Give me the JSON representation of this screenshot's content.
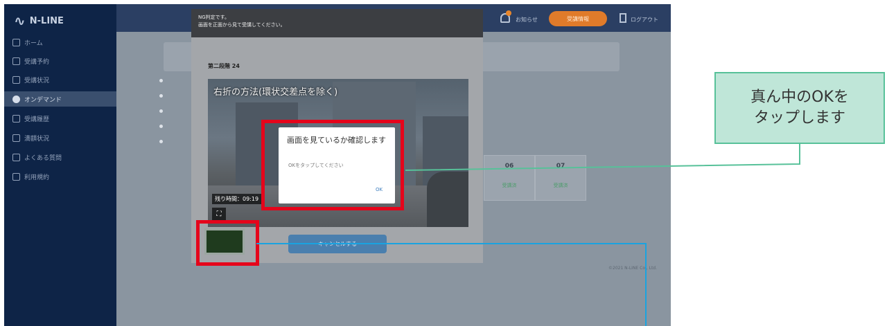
{
  "app": {
    "logo_text": "N-LINE",
    "nav_items": [
      {
        "label": "ホーム",
        "icon": "home-icon"
      },
      {
        "label": "受講予約",
        "icon": "calendar-icon"
      },
      {
        "label": "受講状況",
        "icon": "folder-icon"
      },
      {
        "label": "オンデマンド",
        "icon": "play-icon",
        "active": true
      },
      {
        "label": "受講履歴",
        "icon": "history-icon"
      },
      {
        "label": "満額状況",
        "icon": "people-icon"
      },
      {
        "label": "よくある質問",
        "icon": "faq-icon"
      },
      {
        "label": "利用規約",
        "icon": "terms-icon"
      }
    ],
    "topbar": {
      "notice_label": "お知らせ",
      "orange_button_label": "受講情報",
      "logout_label": "ログアウト"
    },
    "sessions": [
      {
        "number": "06",
        "status": "受講済"
      },
      {
        "number": "07",
        "status": "受講済"
      }
    ],
    "copyright": "©2021 N-LINE Co., Ltd."
  },
  "toast": {
    "line1": "NG判定です。",
    "line2": "画面を正面から見て受講してください。"
  },
  "modal": {
    "title": "第二段階 24",
    "video_title": "右折の方法(環状交差点を除く)",
    "remaining_time": "残り時間：09:19",
    "cancel_label": "キャンセルする"
  },
  "confirm_dialog": {
    "title": "画面を見ているか確認します",
    "message": "OKをタップしてください",
    "ok_label": "OK"
  },
  "callout": {
    "line1": "真ん中のOKを",
    "line2": "タップします"
  },
  "colors": {
    "annotation_red": "#e5051b",
    "callout_fill": "#bfe6d8",
    "callout_border": "#57c199",
    "leader_green": "#57c199",
    "leader_blue": "#1aa3e0",
    "sidebar": "#0e2447"
  }
}
